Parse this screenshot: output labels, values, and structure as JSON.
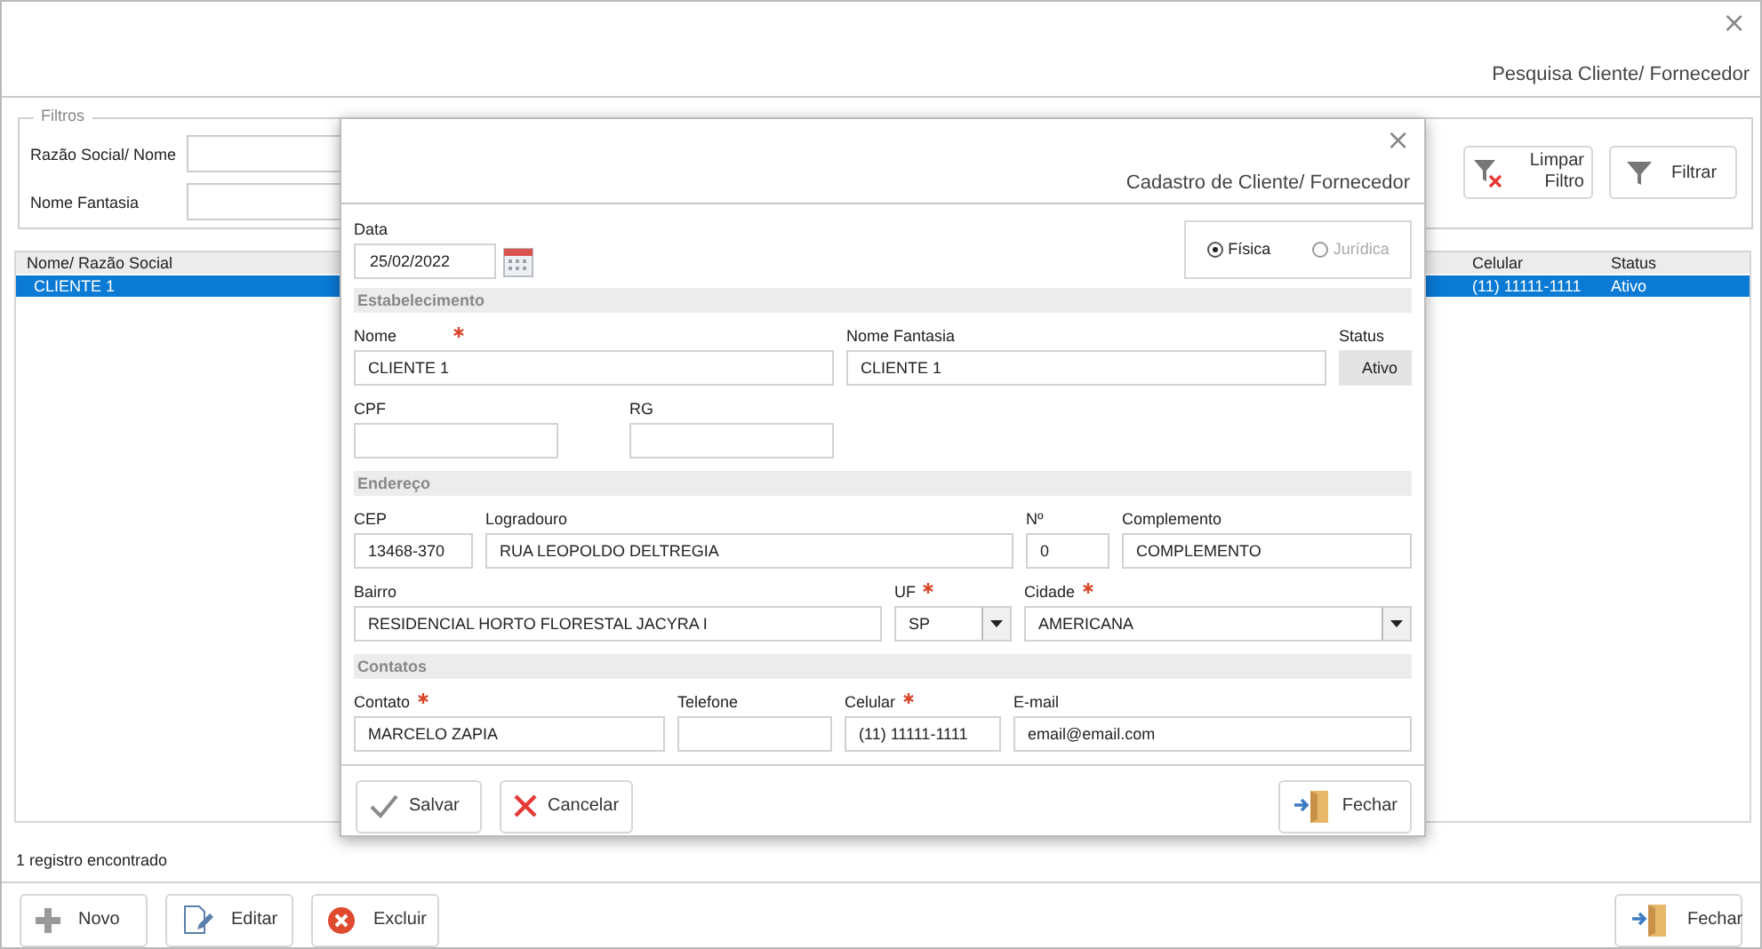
{
  "window": {
    "title": "Pesquisa Cliente/ Fornecedor",
    "close": "×"
  },
  "filters": {
    "legend": "Filtros",
    "fields": [
      {
        "label": "Razão Social/ Nome"
      },
      {
        "label": "Nome Fantasia"
      }
    ],
    "buttons": [
      {
        "kind": "clear-filter",
        "label": "Limpar Filtro"
      },
      {
        "kind": "filter",
        "label": "Filtrar"
      }
    ]
  },
  "table": {
    "columns": [
      {
        "label": "Nome/ Razão Social"
      },
      {
        "label": "Celular"
      },
      {
        "label": "Status"
      }
    ],
    "rows": [
      {
        "cells": [
          "CLIENTE 1",
          "(11) 11111-1111",
          "Ativo"
        ],
        "selected": true
      }
    ]
  },
  "status_text": "1 registro encontrado",
  "toolbar": [
    {
      "kind": "add",
      "label": "Novo"
    },
    {
      "kind": "edit",
      "label": "Editar"
    },
    {
      "kind": "delete",
      "label": "Excluir"
    },
    {
      "kind": "close",
      "label": "Fechar"
    }
  ],
  "dialog": {
    "title": "Cadastro de Cliente/ Fornecedor",
    "close": "×",
    "date": {
      "label": "Data",
      "value": "25/02/2022"
    },
    "person_type": [
      {
        "label": "Física",
        "selected": true,
        "disabled": false
      },
      {
        "label": "Jurídica",
        "selected": false,
        "disabled": true
      }
    ],
    "sections": [
      {
        "title": "Estabelecimento",
        "lines": [
          {
            "fields": [
              {
                "kind": "text",
                "label": "Nome",
                "required": true,
                "value": "CLIENTE 1"
              },
              {
                "kind": "text",
                "label": "Nome Fantasia",
                "required": false,
                "value": "CLIENTE 1"
              },
              {
                "kind": "status",
                "label": "Status",
                "value": "Ativo"
              }
            ]
          },
          {
            "fields": [
              {
                "kind": "text",
                "label": "CPF",
                "required": false
              },
              {
                "kind": "text",
                "label": "RG",
                "required": false
              }
            ]
          }
        ]
      },
      {
        "title": "Endereço",
        "lines": [
          {
            "fields": [
              {
                "kind": "text",
                "label": "CEP",
                "required": false,
                "value": "13468-370"
              },
              {
                "kind": "text",
                "label": "Logradouro",
                "required": false,
                "value": "RUA LEOPOLDO DELTREGIA"
              },
              {
                "kind": "text",
                "label": "Nº",
                "required": false,
                "value": "0"
              },
              {
                "kind": "text",
                "label": "Complemento",
                "required": false,
                "value": "COMPLEMENTO"
              }
            ]
          },
          {
            "fields": [
              {
                "kind": "text",
                "label": "Bairro",
                "required": false,
                "value": "RESIDENCIAL HORTO FLORESTAL JACYRA I"
              },
              {
                "kind": "select",
                "label": "UF",
                "required": true,
                "value": "SP"
              },
              {
                "kind": "select",
                "label": "Cidade",
                "required": true,
                "value": "AMERICANA"
              }
            ]
          }
        ]
      },
      {
        "title": "Contatos",
        "lines": [
          {
            "fields": [
              {
                "kind": "text",
                "label": "Contato",
                "required": true,
                "value": "MARCELO ZAPIA"
              },
              {
                "kind": "text",
                "label": "Telefone",
                "required": false
              },
              {
                "kind": "text",
                "label": "Celular",
                "required": true,
                "value": "(11) 11111-1111"
              },
              {
                "kind": "text",
                "label": "E-mail",
                "required": false,
                "value": "email@email.com"
              }
            ]
          }
        ]
      }
    ],
    "buttons": [
      {
        "kind": "save",
        "label": "Salvar"
      },
      {
        "kind": "cancel",
        "label": "Cancelar"
      },
      {
        "kind": "close",
        "label": "Fechar"
      }
    ]
  }
}
